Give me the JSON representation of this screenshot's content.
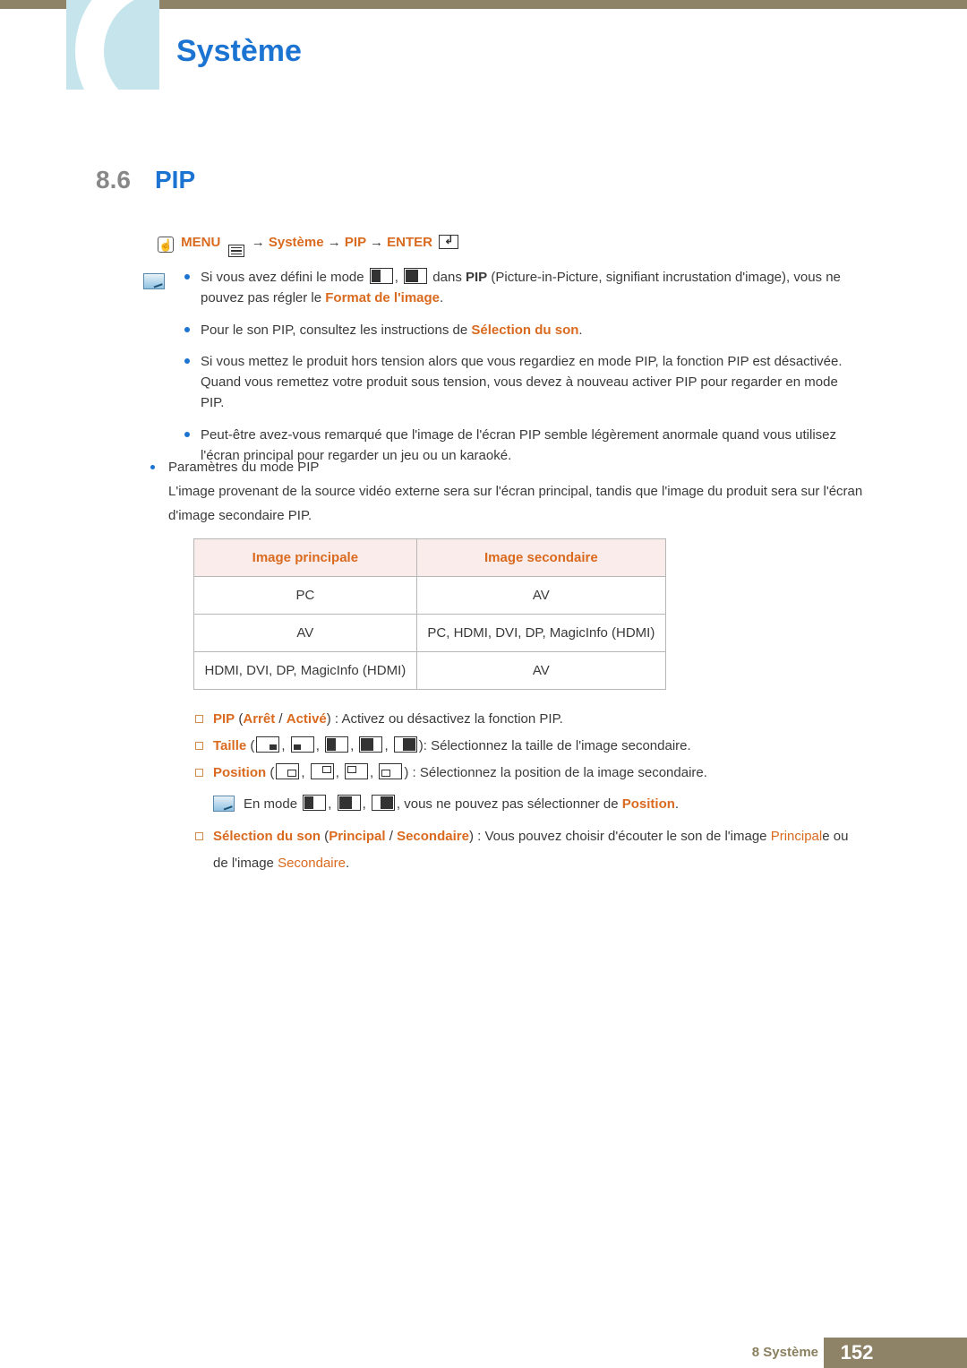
{
  "header": {
    "chapter_title": "Système"
  },
  "section": {
    "number": "8.6",
    "title": "PIP"
  },
  "nav": {
    "menu": "MENU",
    "seg1": "Système",
    "seg2": "PIP",
    "enter": "ENTER"
  },
  "notes": [
    {
      "pre": "Si vous avez défini le mode ",
      "pip_post": " dans ",
      "bold1": "PIP",
      "mid": " (Picture-in-Picture, signifiant incrustation d'image), vous ne pouvez pas régler le ",
      "hl": "Format de l'image",
      "post": "."
    },
    {
      "pre": "Pour le son PIP, consultez les instructions de ",
      "hl": "Sélection du son",
      "post": "."
    },
    {
      "text": "Si vous mettez le produit hors tension alors que vous regardiez en mode PIP, la fonction PIP est désactivée. Quand vous remettez votre produit sous tension, vous devez à nouveau activer PIP pour regarder en mode PIP."
    },
    {
      "text": "Peut-être avez-vous remarqué que l'image de l'écran PIP semble légèrement anormale quand vous utilisez l'écran principal pour regarder un jeu ou un karaoké."
    }
  ],
  "params_heading": "Paramètres du mode PIP",
  "params_desc": "L'image provenant de la source vidéo externe sera sur l'écran principal, tandis que l'image du produit sera sur l'écran d'image secondaire PIP.",
  "table": {
    "h1": "Image principale",
    "h2": "Image secondaire",
    "rows": [
      [
        "PC",
        "AV"
      ],
      [
        "AV",
        "PC, HDMI, DVI, DP, MagicInfo (HDMI)"
      ],
      [
        "HDMI, DVI, DP, MagicInfo (HDMI)",
        "AV"
      ]
    ]
  },
  "opts": {
    "pip": {
      "label": "PIP",
      "off": "Arrêt",
      "on": "Activé",
      "desc": " : Activez ou désactivez la fonction PIP."
    },
    "taille": {
      "label": "Taille",
      "desc": ": Sélectionnez la taille de l'image secondaire."
    },
    "position": {
      "label": "Position",
      "desc": " : Sélectionnez la position de la image secondaire."
    },
    "pos_note": {
      "pre": "En mode ",
      "mid": ", vous ne pouvez pas sélectionner de ",
      "hl": "Position",
      "post": "."
    },
    "son": {
      "label": "Sélection du son",
      "a": "Principal",
      "b": "Secondaire",
      "desc": " : Vous pouvez choisir d'écouter le son de l'image ",
      "p1": "Principal",
      "p1_tail": "e ou de l'image ",
      "p2": "Secondaire",
      "post": "."
    }
  },
  "footer": {
    "label": "8 Système",
    "page": "152"
  }
}
